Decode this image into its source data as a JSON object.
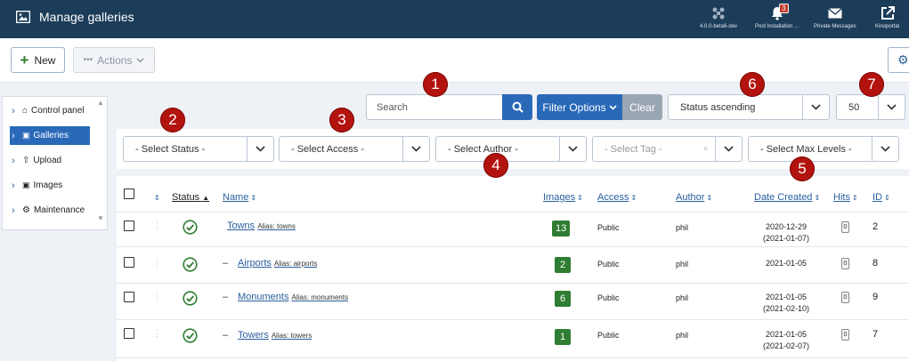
{
  "header": {
    "title": "Manage galleries",
    "items": [
      {
        "label": "4.0.0-beta6-dev",
        "icon": "joomla-icon"
      },
      {
        "label": "Post Installation ...",
        "icon": "bell-icon",
        "badge": "3"
      },
      {
        "label": "Private Messages",
        "icon": "envelope-icon"
      },
      {
        "label": "Kinoportal",
        "icon": "external-link-icon"
      }
    ],
    "bg_color": "#1c3d5a"
  },
  "toolbar": {
    "new_label": "New",
    "actions_label": "Actions"
  },
  "sidebar": {
    "items": [
      {
        "label": "Control panel",
        "icon": "home-icon"
      },
      {
        "label": "Galleries",
        "icon": "image-icon",
        "active": true
      },
      {
        "label": "Upload",
        "icon": "upload-icon"
      },
      {
        "label": "Images",
        "icon": "image-icon"
      },
      {
        "label": "Maintenance",
        "icon": "cogs-icon"
      }
    ]
  },
  "search": {
    "placeholder": "Search",
    "filter_options": "Filter Options",
    "clear": "Clear",
    "ordering": "Status ascending",
    "limit": "50"
  },
  "filters": {
    "status": "- Select Status -",
    "access": "- Select Access -",
    "author": "- Select Author -",
    "tag": "- Select Tag -",
    "max_levels": "- Select Max Levels -"
  },
  "callouts": [
    "1",
    "2",
    "3",
    "4",
    "5",
    "6",
    "7"
  ],
  "table": {
    "headers": {
      "status": "Status",
      "name": "Name",
      "images": "Images",
      "access": "Access",
      "author": "Author",
      "date_created": "Date Created",
      "hits": "Hits",
      "id": "ID"
    },
    "rows": [
      {
        "dash": "",
        "name": "Towns",
        "alias": "Alias: towns",
        "images": "13",
        "access": "Public",
        "author": "phil",
        "date1": "2020-12-29",
        "date2": "(2021-01-07)",
        "hits": "0",
        "id": "2"
      },
      {
        "dash": "–",
        "name": "Airports",
        "alias": "Alias: airports",
        "images": "2",
        "access": "Public",
        "author": "phil",
        "date1": "2021-01-05",
        "date2": "",
        "hits": "0",
        "id": "8"
      },
      {
        "dash": "–",
        "name": "Monuments",
        "alias": "Alias: monuments",
        "images": "6",
        "access": "Public",
        "author": "phil",
        "date1": "2021-01-05",
        "date2": "(2021-02-10)",
        "hits": "0",
        "id": "9"
      },
      {
        "dash": "–",
        "name": "Towers",
        "alias": "Alias: towers",
        "images": "1",
        "access": "Public",
        "author": "phil",
        "date1": "2021-01-05",
        "date2": "(2021-02-07)",
        "hits": "0",
        "id": "7"
      }
    ]
  }
}
